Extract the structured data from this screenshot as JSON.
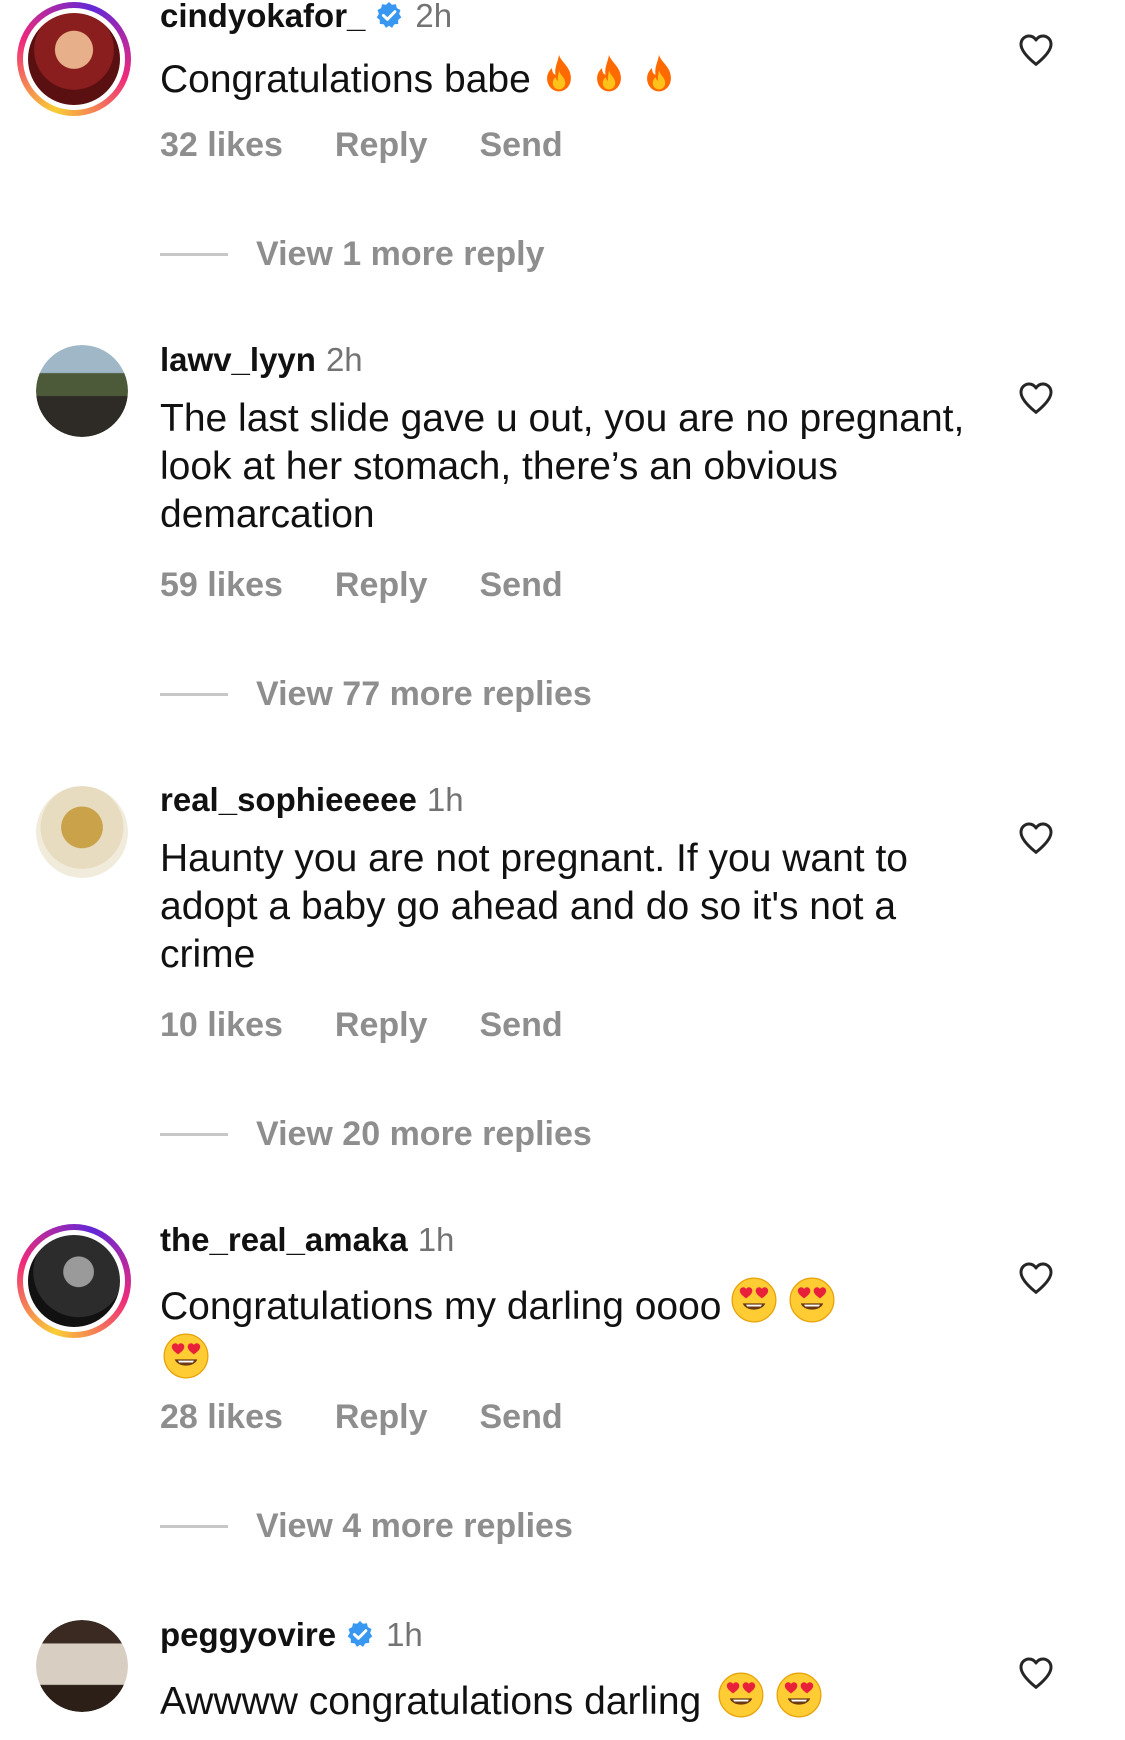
{
  "comments": [
    {
      "username": "cindyokafor_",
      "verified": true,
      "time": "2h",
      "text": "Congratulations babe",
      "emoji": [
        "fire-emoji",
        "fire-emoji",
        "fire-emoji"
      ],
      "likes": "32 likes",
      "reply": "Reply",
      "send": "Send",
      "view_more": "View 1 more reply",
      "story_ring": true
    },
    {
      "username": "lawv_lyyn",
      "verified": false,
      "time": "2h",
      "text": "The last slide gave u out, you are no pregnant, look at her stomach, there’s an obvious demarcation",
      "likes": "59 likes",
      "reply": "Reply",
      "send": "Send",
      "view_more": "View 77 more replies",
      "story_ring": false
    },
    {
      "username": "real_sophieeeee",
      "verified": false,
      "time": "1h",
      "text": "Haunty you are not pregnant. If you want to adopt a baby go ahead and do so it's not a crime",
      "likes": "10 likes",
      "reply": "Reply",
      "send": "Send",
      "view_more": "View 20 more replies",
      "story_ring": false
    },
    {
      "username": "the_real_amaka",
      "verified": false,
      "time": "1h",
      "text": "Congratulations my darling oooo",
      "emoji": [
        "heart-eyes-emoji",
        "heart-eyes-emoji",
        "heart-eyes-emoji"
      ],
      "likes": "28 likes",
      "reply": "Reply",
      "send": "Send",
      "view_more": "View 4 more replies",
      "story_ring": true
    },
    {
      "username": "peggyovire",
      "verified": true,
      "time": "1h",
      "text": "Awwww congratulations darling",
      "emoji": [
        "heart-eyes-emoji",
        "heart-eyes-emoji"
      ],
      "story_ring": false
    }
  ],
  "colors": {
    "secondary_text": "#737373",
    "action_text": "#8e8e8e",
    "verified_blue": "#3897f0",
    "fire": "#ff7a00",
    "emoji_yellow": "#ffcc33",
    "emoji_heart": "#e8203a"
  }
}
